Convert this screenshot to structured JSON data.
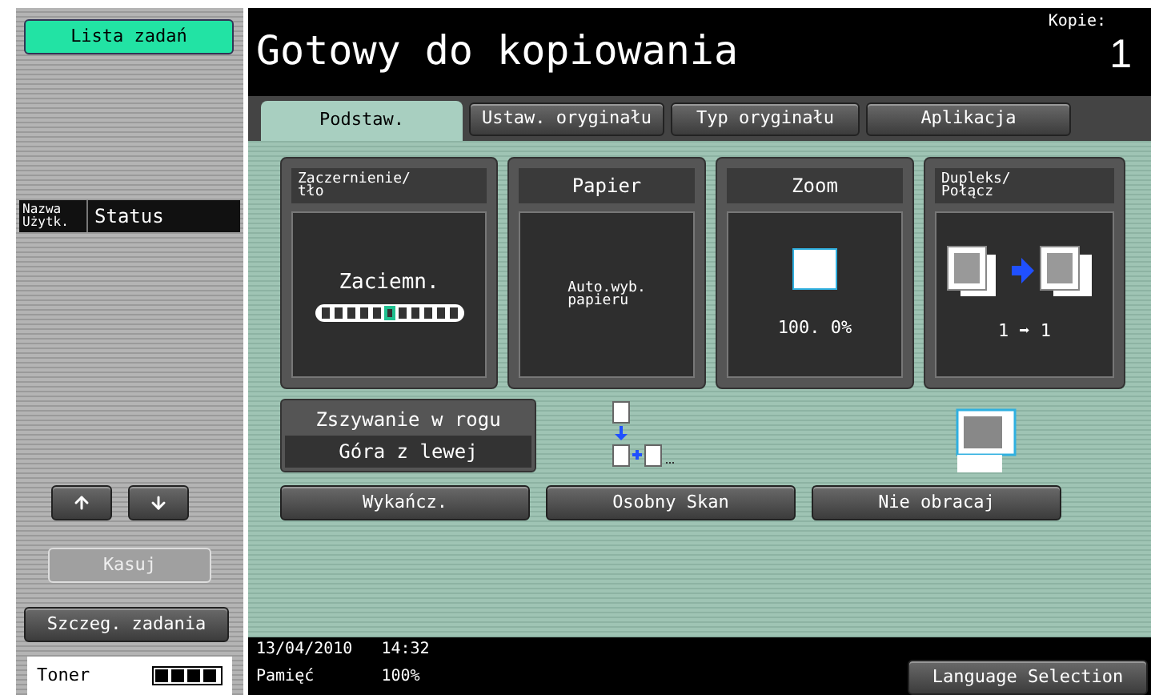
{
  "sidebar": {
    "job_list_button": "Lista zadań",
    "columns": [
      "Nazwa\nUżytk.",
      "Status"
    ],
    "scroll_buttons": [
      {
        "kind": "up"
      },
      {
        "kind": "down"
      }
    ],
    "delete_button": {
      "label": "Kasuj",
      "disabled": true
    },
    "details_button": "Szczeg. zadania",
    "toner": {
      "label": "Toner",
      "level": 1
    }
  },
  "header": {
    "title": "Gotowy do kopiowania",
    "copies_label": "Kopie:",
    "copies": "1"
  },
  "tabs": [
    {
      "label": "Podstaw.",
      "selected": true
    },
    {
      "label": "Ustaw. oryginału",
      "selected": false
    },
    {
      "label": "Typ oryginału",
      "selected": false
    },
    {
      "label": "Aplikacja",
      "selected": false
    }
  ],
  "cards": [
    {
      "kind": "density",
      "title": "Zaczernienie/\ntło",
      "value": "Zaciemn.",
      "segments": [
        {
          "selected": false
        },
        {
          "selected": false
        },
        {
          "selected": false
        },
        {
          "selected": false
        },
        {
          "selected": false
        },
        {
          "selected": true
        },
        {
          "selected": false
        },
        {
          "selected": false
        },
        {
          "selected": false
        },
        {
          "selected": false
        },
        {
          "selected": false
        }
      ]
    },
    {
      "kind": "text",
      "title": "Papier",
      "value": "Auto.wyb.\npapieru"
    },
    {
      "kind": "zoom",
      "title": "Zoom",
      "value": "100. 0%"
    },
    {
      "kind": "duplex",
      "title": "Dupleks/\nPołącz",
      "value": "1 ➡ 1"
    }
  ],
  "staple": {
    "title": "Zszywanie w rogu",
    "value": "Góra z lewej"
  },
  "buttons": [
    "Wykańcz.",
    "Osobny Skan",
    "Nie obracaj"
  ],
  "footer": {
    "date": "13/04/2010",
    "time": "14:32",
    "memory_label": "Pamięć",
    "memory": "100%",
    "language_button": "Language Selection"
  }
}
